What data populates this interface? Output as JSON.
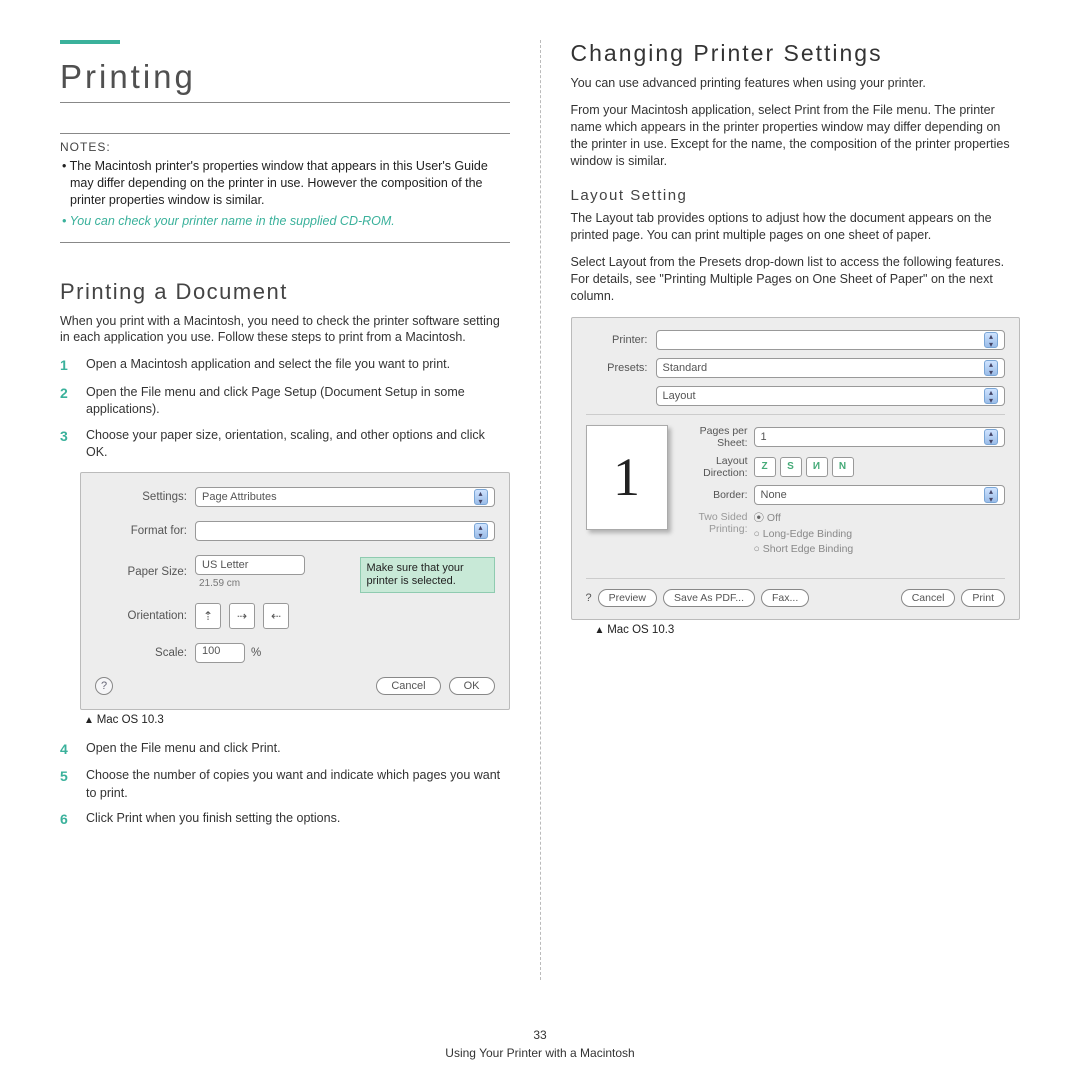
{
  "left": {
    "title": "Printing",
    "notes_label": "NOTES:",
    "notes": [
      "The Macintosh printer's properties window that appears in this User's Guide may differ depending on the printer in use. However the composition of the printer properties window is similar.",
      "You can check your printer name in the supplied CD-ROM."
    ],
    "h2": "Printing a Document",
    "intro": "When you print with a Macintosh, you need to check the printer software setting in each application you use. Follow these steps to print from a Macintosh.",
    "steps1": [
      "Open a Macintosh application and select the file you want to print.",
      "Open the File menu and click Page Setup (Document Setup in some applications).",
      "Choose your paper size, orientation, scaling, and other options and click OK."
    ],
    "dialog1": {
      "settings_label": "Settings:",
      "settings_value": "Page Attributes",
      "format_label": "Format for:",
      "format_value": "",
      "paper_label": "Paper Size:",
      "paper_value": "US Letter",
      "paper_dim": "21.59 cm",
      "orient_label": "Orientation:",
      "scale_label": "Scale:",
      "scale_value": "100",
      "scale_unit": "%",
      "cancel": "Cancel",
      "ok": "OK",
      "callout": "Make sure that your printer is selected."
    },
    "caption1": "Mac OS 10.3",
    "steps2": [
      "Open the File menu and click Print.",
      "Choose the number of copies you want and indicate which pages you want to print.",
      "Click Print when you finish setting the options."
    ]
  },
  "right": {
    "title": "Changing Printer Settings",
    "para1": "You can use advanced printing features when using your printer.",
    "para2": "From your Macintosh application, select Print from the File menu. The printer name which appears in the printer properties window may differ depending on the printer in use. Except for the name, the composition of the printer properties window is similar.",
    "h3": "Layout Setting",
    "para3": "The Layout tab provides options to adjust how the document appears on the printed page. You can print multiple pages on one sheet of paper.",
    "para4": "Select Layout from the Presets drop-down list to access the following features. For details, see \"Printing Multiple Pages on One Sheet of Paper\" on the next column.",
    "dialog2": {
      "printer_label": "Printer:",
      "presets_label": "Presets:",
      "presets_value": "Standard",
      "section_value": "Layout",
      "pps_label": "Pages per Sheet:",
      "pps_value": "1",
      "dir_label": "Layout Direction:",
      "border_label": "Border:",
      "border_value": "None",
      "two_label": "Two Sided Printing:",
      "radio_off": "Off",
      "radio_long": "Long-Edge Binding",
      "radio_short": "Short Edge Binding",
      "preview_num": "1",
      "btn_preview": "Preview",
      "btn_save": "Save As PDF...",
      "btn_fax": "Fax...",
      "btn_cancel": "Cancel",
      "btn_print": "Print"
    },
    "caption2": "Mac OS 10.3"
  },
  "footer": {
    "page": "33",
    "text": "Using Your Printer with a Macintosh"
  }
}
